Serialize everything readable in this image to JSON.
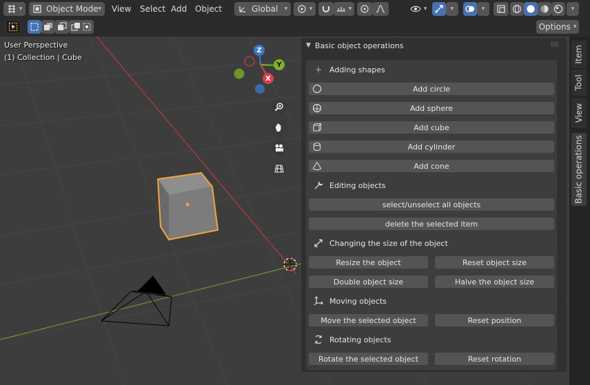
{
  "header": {
    "mode_label": "Object Mode",
    "menus": [
      "View",
      "Select",
      "Add",
      "Object"
    ],
    "transform_orientation": "Global",
    "options_label": "Options"
  },
  "viewport": {
    "view_name": "User Perspective",
    "collection_info": "(1) Collection | Cube",
    "gizmo": {
      "z": "Z",
      "y": "Y",
      "x": "X"
    }
  },
  "panel": {
    "title": "Basic object operations",
    "sections": {
      "adding": "Adding shapes",
      "editing": "Editing objects",
      "size": "Changing the size of the object",
      "moving": "Moving objects",
      "rotating": "Rotating objects"
    },
    "buttons": {
      "add_circle": "Add circle",
      "add_sphere": "Add sphere",
      "add_cube": "Add cube",
      "add_cylinder": "Add cylinder",
      "add_cone": "Add cone",
      "select_all": "select/unselect all objects",
      "delete_item": "delete the selected item",
      "resize": "Resize the object",
      "reset_size": "Reset object size",
      "double_size": "Double object size",
      "halve_size": "Halve the object size",
      "move": "Move the selected object",
      "reset_position": "Reset position",
      "rotate": "Rotate the selected object",
      "reset_rotation": "Reset rotation"
    }
  },
  "sidebar_tabs": {
    "item": "Item",
    "tool": "Tool",
    "view": "View",
    "basic": "Basic operations"
  },
  "colors": {
    "accent_blue": "#4772b3",
    "selection_orange": "#f5a33b",
    "axis_red": "#c0383b",
    "axis_green": "#6b9a24"
  }
}
